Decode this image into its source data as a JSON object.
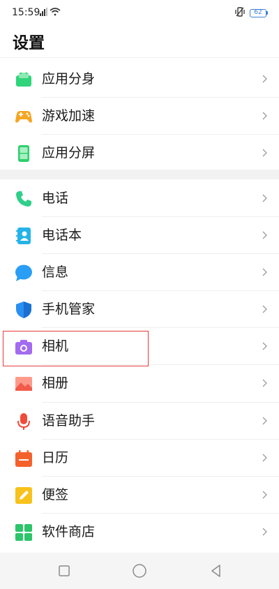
{
  "status_bar": {
    "time": "15:59",
    "battery_level": "62",
    "signal_icon": "signal-icon",
    "wifi_icon": "wifi-icon",
    "mute_icon": "vibrate-icon"
  },
  "header": {
    "title": "设置"
  },
  "group1": [
    {
      "label": "应用分身",
      "icon": "app-clone-icon"
    },
    {
      "label": "游戏加速",
      "icon": "gamepad-icon"
    },
    {
      "label": "应用分屏",
      "icon": "split-screen-icon"
    }
  ],
  "group2": [
    {
      "label": "电话",
      "icon": "phone-icon"
    },
    {
      "label": "电话本",
      "icon": "contacts-icon"
    },
    {
      "label": "信息",
      "icon": "message-icon"
    },
    {
      "label": "手机管家",
      "icon": "shield-icon"
    },
    {
      "label": "相机",
      "icon": "camera-icon"
    },
    {
      "label": "相册",
      "icon": "gallery-icon"
    },
    {
      "label": "语音助手",
      "icon": "microphone-icon"
    },
    {
      "label": "日历",
      "icon": "calendar-icon"
    },
    {
      "label": "便签",
      "icon": "notes-icon"
    },
    {
      "label": "软件商店",
      "icon": "app-store-icon"
    }
  ],
  "colors": {
    "highlight_border": "#e63a3a",
    "battery": "#3a7fd8"
  }
}
